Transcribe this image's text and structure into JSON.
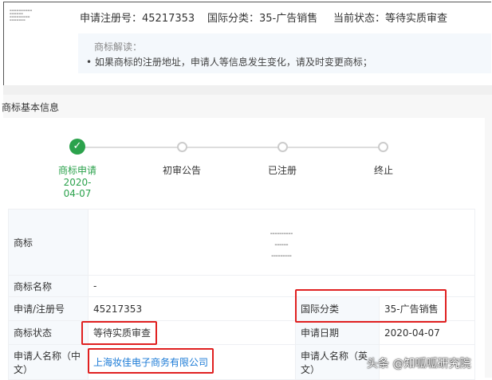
{
  "header": {
    "reg_no": "申请注册号：45217353",
    "class": "国际分类：35-广告销售",
    "status": "当前状态：等待实质审查"
  },
  "tip": {
    "title": "商标解读：",
    "line": "• 如果商标的注册地址，申请人等信息发生变化，请及时变更商标；"
  },
  "section_title": "商标基本信息",
  "steps": [
    {
      "label": "商标申请",
      "date": "2020-",
      "date2": "04-07",
      "done": true
    },
    {
      "label": "初审公告"
    },
    {
      "label": "已注册"
    },
    {
      "label": "终止"
    }
  ],
  "table": {
    "logo_label": "商标",
    "name_label": "商标名称",
    "name_value": "-",
    "regno_label": "申请/注册号",
    "regno_value": "45217353",
    "class_label": "国际分类",
    "class_value": "35-广告销售",
    "status_label": "商标状态",
    "status_value": "等待实质审查",
    "date_label": "申请日期",
    "date_value": "2020-04-07",
    "applicant_cn_label": "申请人名称（中文）",
    "applicant_cn_value": "上海妆佳电子商务有限公司",
    "applicant_en_label": "申请人名称（英文）"
  },
  "watermark": "头条 @知呱呱研究院"
}
